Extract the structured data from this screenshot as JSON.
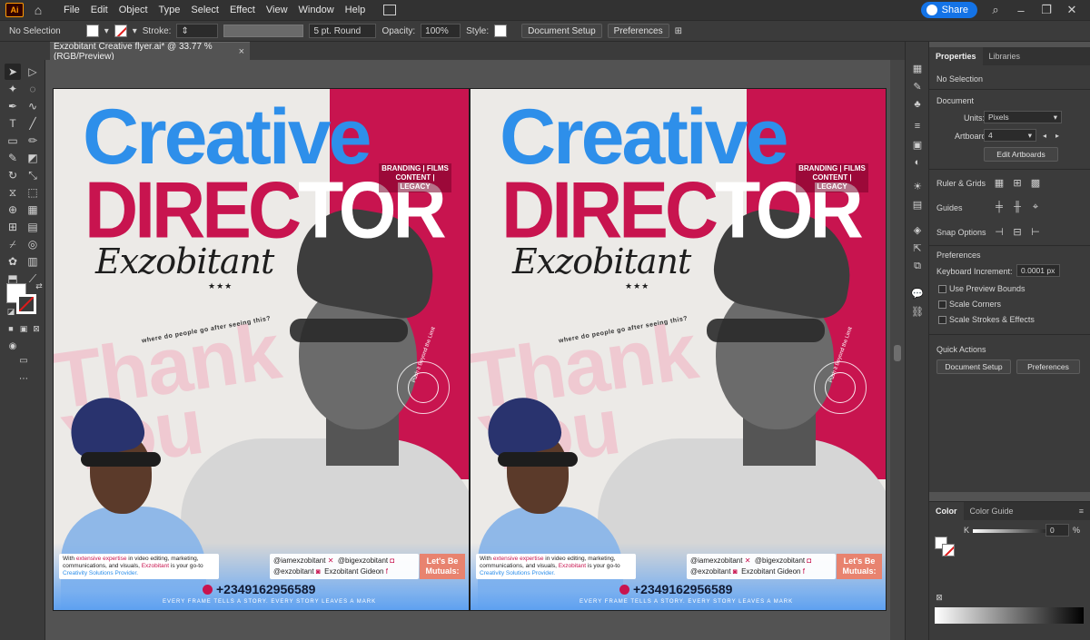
{
  "menubar": {
    "app": "Ai",
    "menus": [
      "File",
      "Edit",
      "Object",
      "Type",
      "Select",
      "Effect",
      "View",
      "Window",
      "Help"
    ],
    "share": "Share"
  },
  "controlbar": {
    "selection": "No Selection",
    "stroke_label": "Stroke:",
    "brush": "5 pt. Round",
    "opacity_label": "Opacity:",
    "opacity": "100%",
    "style_label": "Style:",
    "document_setup": "Document Setup",
    "preferences": "Preferences"
  },
  "document_tab": {
    "title": "Exzobitant Creative flyer.ai* @ 33.77 % (RGB/Preview)",
    "close": "×"
  },
  "flyer": {
    "title_line1": "Creative",
    "title_line2_red": "DIREC",
    "title_line2_white": "TOR",
    "tagline_line1": "BRANDING | FILMS",
    "tagline_line2": "CONTENT | LEGACY",
    "signature": "Exzobitant",
    "stars": "★★★",
    "question": "where do people go after seeing this?",
    "ghost_line1": "Thank",
    "ghost_line2": "You",
    "badge_text": "Push it Beyond the Limit",
    "desc_pre": "With ",
    "desc_hl": "extensive expertise",
    "desc_mid": " in video editing, marketing, communications, and visuals, ",
    "desc_brand": "Exzobitant",
    "desc_post": " is your go-to ",
    "desc_end": "Creativity Solutions Provider.",
    "social1": "@iamexzobitant",
    "social2": "@bigexzobitant",
    "social3": "@exzobitant",
    "social4": "Exzobitant Gideon",
    "mutuals_line1": "Let's Be",
    "mutuals_line2": "Mutuals:",
    "phone": "+2349162956589",
    "footer": "EVERY FRAME TELLS A STORY. EVERY STORY LEAVES A MARK"
  },
  "properties": {
    "tabs": [
      "Properties",
      "Libraries"
    ],
    "no_selection": "No Selection",
    "document": "Document",
    "units_label": "Units:",
    "units": "Pixels",
    "artboard_label": "Artboard:",
    "artboard": "4",
    "edit_artboards": "Edit Artboards",
    "ruler_grids": "Ruler & Grids",
    "guides": "Guides",
    "snap_options": "Snap Options",
    "preferences": "Preferences",
    "keyboard_increment_label": "Keyboard Increment:",
    "keyboard_increment": "0.0001 px",
    "use_preview_bounds": "Use Preview Bounds",
    "scale_corners": "Scale Corners",
    "scale_strokes": "Scale Strokes & Effects",
    "quick_actions": "Quick Actions",
    "document_setup": "Document Setup",
    "preferences_btn": "Preferences"
  },
  "color_panel": {
    "tabs": [
      "Color",
      "Color Guide"
    ],
    "k_label": "K",
    "k_value": "0",
    "percent": "%",
    "menu": "≡"
  }
}
